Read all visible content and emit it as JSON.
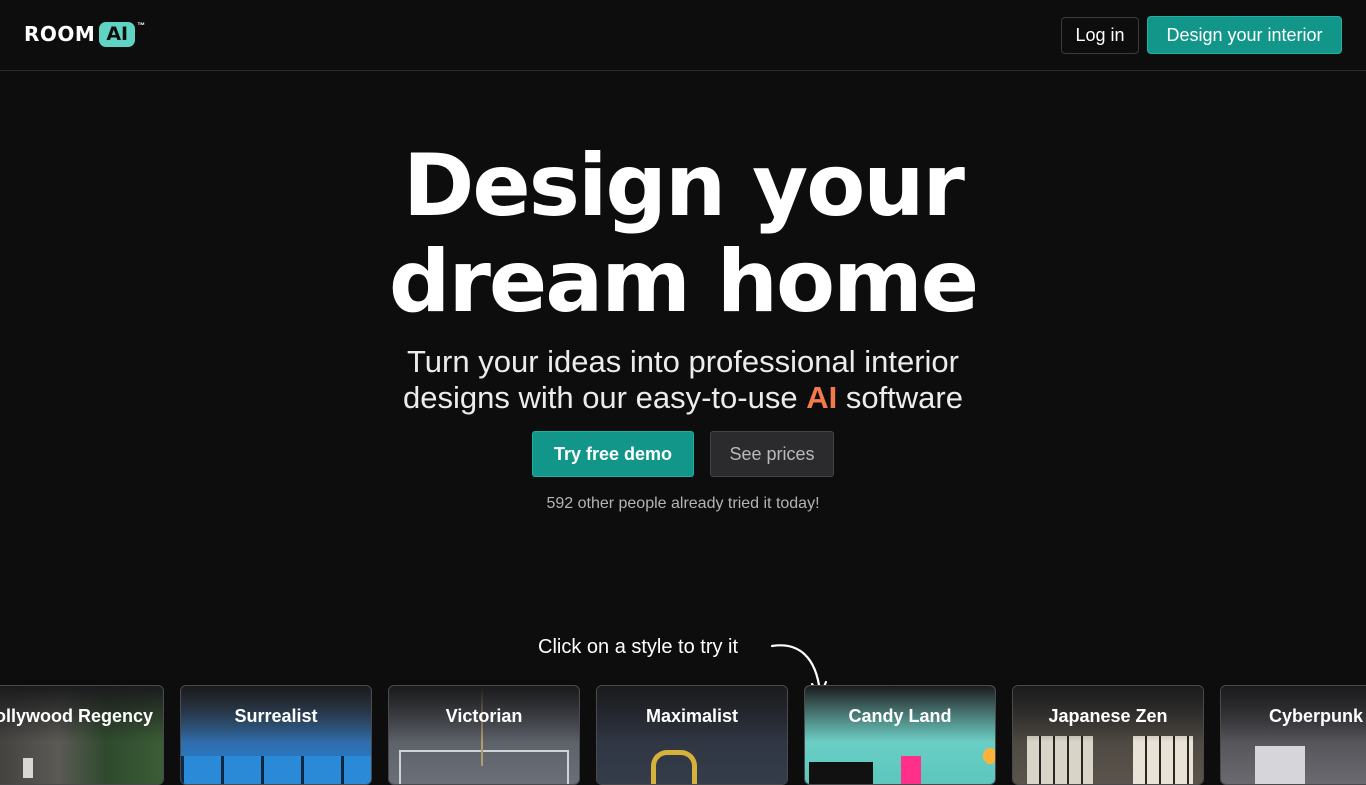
{
  "nav": {
    "logo_word": "ROOM",
    "logo_badge": "AI",
    "logo_tm": "™",
    "login_label": "Log in",
    "design_label": "Design your interior"
  },
  "hero": {
    "title_line1": "Design your",
    "title_line2": "dream home",
    "subtitle_line1": "Turn your ideas into professional interior",
    "subtitle_line2_a": "designs with our easy-to-use",
    "subtitle_line2_ai": "AI",
    "subtitle_line2_b": "software",
    "demo_label": "Try free demo",
    "prices_label": "See prices",
    "social_proof": "592 other people already tried it today!"
  },
  "styles": {
    "hint": "Click on a style to try it",
    "items": [
      {
        "label": "ollywood Regency"
      },
      {
        "label": "Surrealist"
      },
      {
        "label": "Victorian"
      },
      {
        "label": "Maximalist"
      },
      {
        "label": "Candy Land"
      },
      {
        "label": "Japanese Zen"
      },
      {
        "label": "Cyberpunk"
      }
    ]
  },
  "colors": {
    "background": "#0d0d0e",
    "accent_teal": "#13968a",
    "ai_orange": "#f47a4c",
    "logo_badge": "#5fd4c4"
  }
}
